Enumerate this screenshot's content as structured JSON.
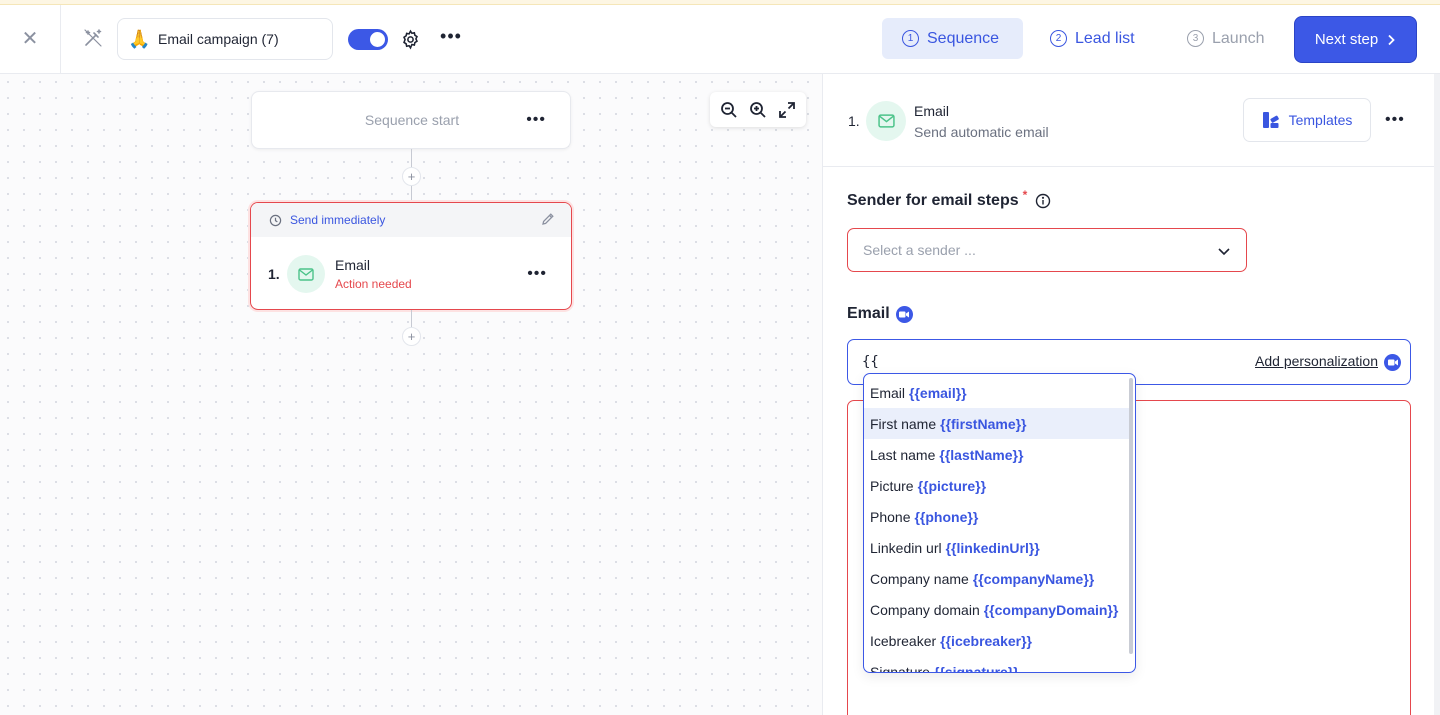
{
  "header": {
    "campaign_emoji": "🙏",
    "campaign_name": "Email campaign (7)",
    "toggle_on": true,
    "steps": [
      {
        "num": "1",
        "label": "Sequence"
      },
      {
        "num": "2",
        "label": "Lead list"
      },
      {
        "num": "3",
        "label": "Launch"
      }
    ],
    "next_label": "Next step"
  },
  "canvas": {
    "sequence_start_label": "Sequence start",
    "step_timing": "Send immediately",
    "step_number": "1.",
    "step_title": "Email",
    "step_status": "Action needed"
  },
  "panel": {
    "step_number": "1.",
    "step_title": "Email",
    "step_subtitle": "Send automatic email",
    "templates_label": "Templates",
    "sender_label": "Sender for email steps",
    "sender_required": "*",
    "sender_placeholder": "Select a sender ...",
    "email_label": "Email",
    "subject_value": "{{",
    "add_personalization": "Add personalization"
  },
  "dropdown": {
    "items": [
      {
        "label": "Email",
        "tag": "{{email}}"
      },
      {
        "label": "First name",
        "tag": "{{firstName}}"
      },
      {
        "label": "Last name",
        "tag": "{{lastName}}"
      },
      {
        "label": "Picture",
        "tag": "{{picture}}"
      },
      {
        "label": "Phone",
        "tag": "{{phone}}"
      },
      {
        "label": "Linkedin url",
        "tag": "{{linkedinUrl}}"
      },
      {
        "label": "Company name",
        "tag": "{{companyName}}"
      },
      {
        "label": "Company domain",
        "tag": "{{companyDomain}}"
      },
      {
        "label": "Icebreaker",
        "tag": "{{icebreaker}}"
      },
      {
        "label": "Signature",
        "tag": "{{signature}}"
      }
    ],
    "highlighted_index": 1
  },
  "colors": {
    "accent": "#3c58e6",
    "error": "#e5484d",
    "email_icon_bg": "#e4f7ef",
    "email_icon": "#4cc38a"
  }
}
